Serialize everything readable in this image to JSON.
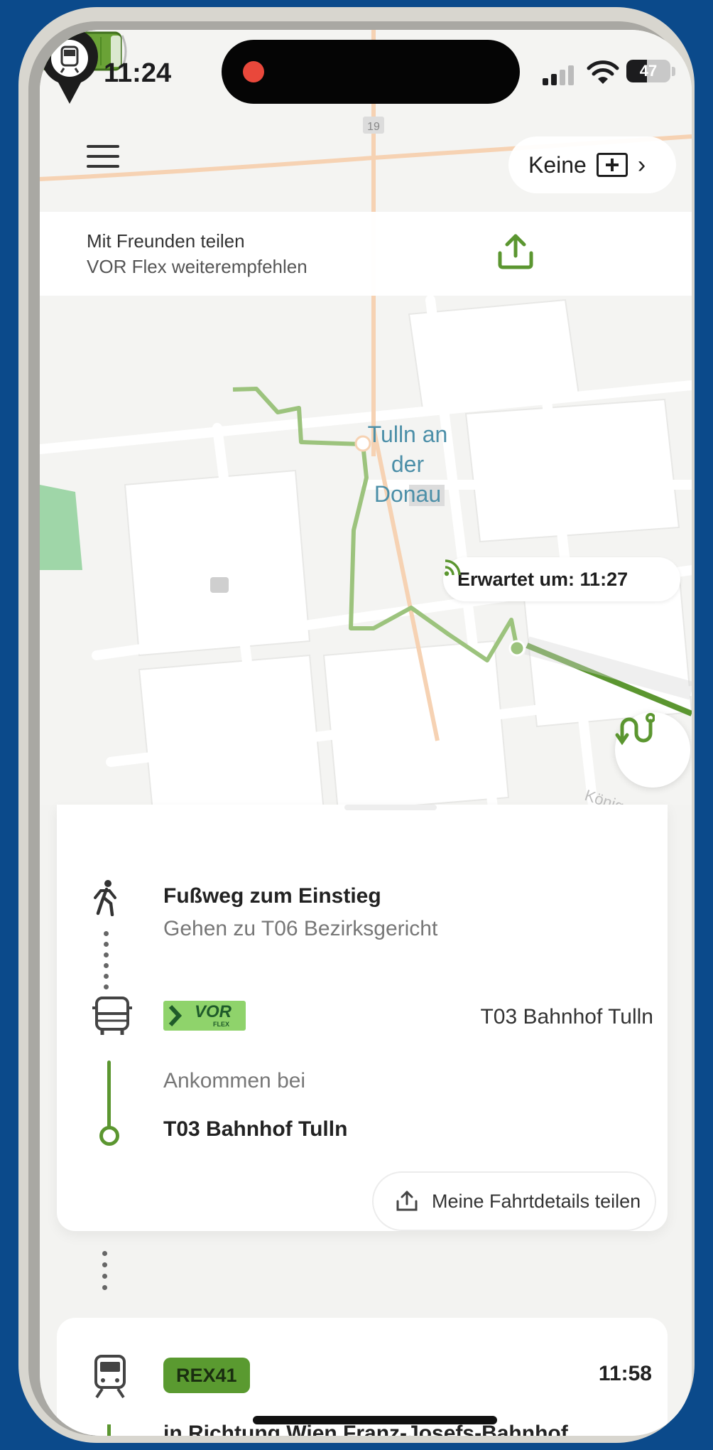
{
  "status_bar": {
    "time": "11:24",
    "battery": "47",
    "battery_level": 0.47
  },
  "header": {
    "ticket_label": "Keine"
  },
  "share_banner": {
    "title": "Mit Freunden teilen",
    "subtitle": "VOR Flex weiterempfehlen"
  },
  "map": {
    "place_line1": "Tulln an",
    "place_line2": "der Donau",
    "road_number": "19",
    "expected": "Erwartet um: 11:27",
    "street_label": "Königstetter Str."
  },
  "trip": {
    "walk": {
      "title": "Fußweg zum Einstieg",
      "subtitle": "Gehen zu T06 Bezirksgericht"
    },
    "flex": {
      "operator": "VOR",
      "operator_sub": "FLEX",
      "destination": "T03 Bahnhof Tulln",
      "arrive_label": "Ankommen bei",
      "arrive_stop": "T03 Bahnhof Tulln"
    },
    "share_button": "Meine Fahrtdetails teilen",
    "train": {
      "line": "REX41",
      "time": "11:58",
      "direction": "in Richtung Wien Franz-Josefs-Bahnhof"
    }
  },
  "colors": {
    "accent_green": "#5b9630",
    "flex_green": "#8fd36b",
    "route_light": "#9cc37d",
    "background": "#0b4a8b"
  }
}
